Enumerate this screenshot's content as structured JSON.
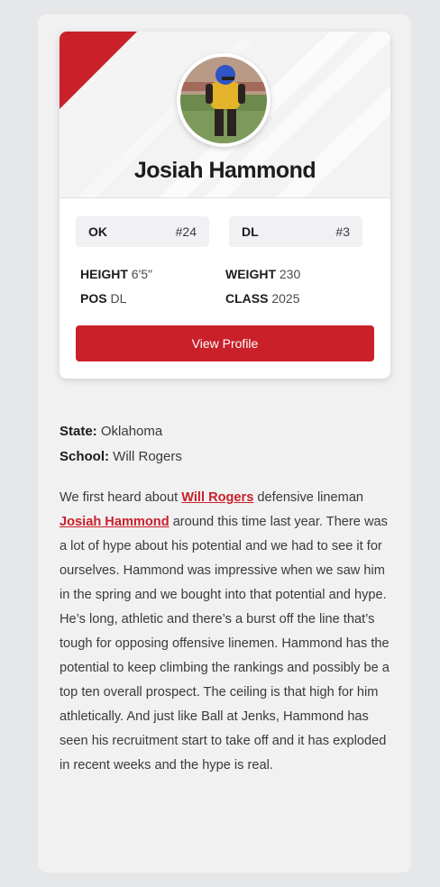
{
  "player": {
    "name": "Josiah Hammond",
    "avatar_icon": "player-photo"
  },
  "badges": [
    {
      "key": "OK",
      "value": "#24"
    },
    {
      "key": "DL",
      "value": "#3"
    }
  ],
  "stats": {
    "height_label": "HEIGHT",
    "height_value": "6'5\"",
    "weight_label": "WEIGHT",
    "weight_value": "230",
    "pos_label": "POS",
    "pos_value": "DL",
    "class_label": "CLASS",
    "class_value": "2025"
  },
  "view_profile_label": "View Profile",
  "info": {
    "state_label": "State:",
    "state_value": "Oklahoma",
    "school_label": "School:",
    "school_value": "Will Rogers"
  },
  "article": {
    "p1": "We first heard about ",
    "link_school": "Will Rogers",
    "p2": " defensive lineman ",
    "link_player": "Josiah Hammond",
    "p3": " around this time last year. There was a lot of hype about his potential and we had to see it for ourselves. Hammond was impressive when we saw him in the spring and we bought into that potential and hype. He’s long, athletic and there’s a burst off the line that’s tough for opposing offensive linemen. Hammond has the potential to keep climbing the rankings and possibly be a top ten overall prospect. The ceiling is that high for him athletically. And just like Ball at Jenks, Hammond has seen his recruitment start to take off and it has exploded in recent weeks and the hype is real."
  },
  "colors": {
    "accent": "#c9202a",
    "page_bg": "#e6e7e9",
    "panel_bg": "#f1f1f2"
  }
}
